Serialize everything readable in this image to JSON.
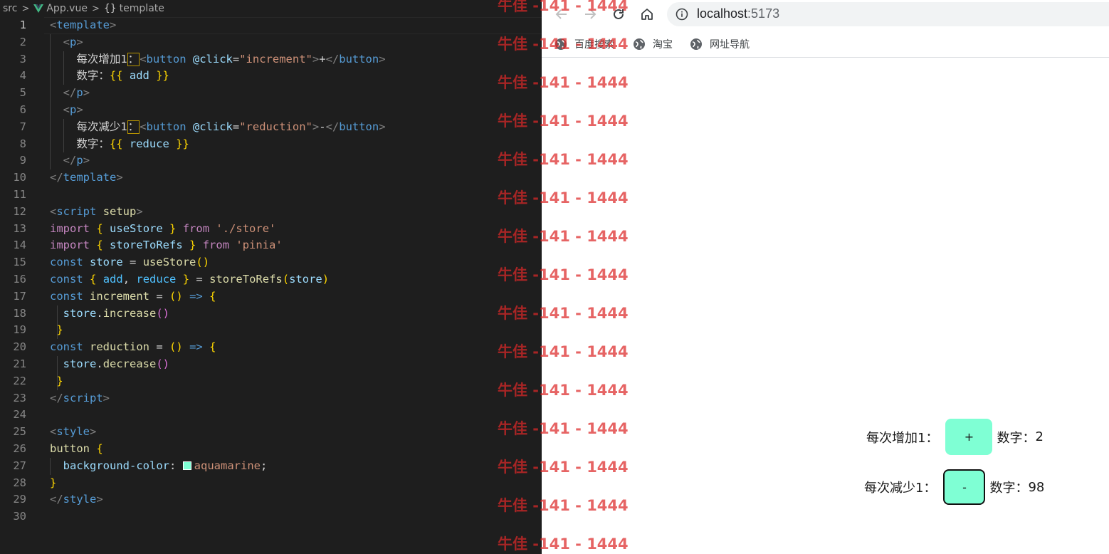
{
  "editor": {
    "breadcrumb": {
      "folder": "src",
      "file": "App.vue",
      "symbol": "template",
      "symbol_icon": "{}"
    },
    "active_line": 1,
    "line_numbers": [
      "1",
      "2",
      "3",
      "4",
      "5",
      "6",
      "7",
      "8",
      "9",
      "10",
      "11",
      "12",
      "13",
      "14",
      "15",
      "16",
      "17",
      "18",
      "19",
      "20",
      "21",
      "22",
      "23",
      "24",
      "25",
      "26",
      "27",
      "28",
      "29",
      "30"
    ],
    "code": {
      "l1": {
        "a": "<",
        "b": "template",
        "c": ">"
      },
      "l2": {
        "a": "<",
        "b": "p",
        "c": ">"
      },
      "l3": {
        "a": "每次增加1",
        "b": "：",
        "c": "<",
        "d": "button",
        "e": "@click",
        "f": "=",
        "g": "\"increment\"",
        "h": ">",
        "i": "+",
        "j": "</",
        "k": "button",
        "l": ">"
      },
      "l4": {
        "a": "数字：",
        "b": "{{",
        "c": "add",
        "d": "}}"
      },
      "l5": {
        "a": "</",
        "b": "p",
        "c": ">"
      },
      "l6": {
        "a": "<",
        "b": "p",
        "c": ">"
      },
      "l7": {
        "a": "每次减少1",
        "b": "：",
        "c": "<",
        "d": "button",
        "e": "@click",
        "f": "=",
        "g": "\"reduction\"",
        "h": ">",
        "i": "-",
        "j": "</",
        "k": "button",
        "l": ">"
      },
      "l8": {
        "a": "数字：",
        "b": "{{",
        "c": "reduce",
        "d": "}}"
      },
      "l9": {
        "a": "</",
        "b": "p",
        "c": ">"
      },
      "l10": {
        "a": "</",
        "b": "template",
        "c": ">"
      },
      "l12": {
        "a": "<",
        "b": "script",
        "c": "setup",
        "d": ">"
      },
      "l13": {
        "a": "import",
        "b": "{",
        "c": "useStore",
        "d": "}",
        "e": "from",
        "f": "'./store'"
      },
      "l14": {
        "a": "import",
        "b": "{",
        "c": "storeToRefs",
        "d": "}",
        "e": "from",
        "f": "'pinia'"
      },
      "l15": {
        "a": "const",
        "b": "store",
        "c": "=",
        "d": "useStore",
        "e": "()"
      },
      "l16": {
        "a": "const",
        "b": "{",
        "c": "add",
        "d": ",",
        "e": "reduce",
        "f": "}",
        "g": "=",
        "h": "storeToRefs",
        "i": "(",
        "j": "store",
        "k": ")"
      },
      "l17": {
        "a": "const",
        "b": "increment",
        "c": "=",
        "d": "()",
        "e": "=>",
        "f": "{"
      },
      "l18": {
        "a": "store",
        "b": ".",
        "c": "increase",
        "d": "()"
      },
      "l19": {
        "a": "}"
      },
      "l20": {
        "a": "const",
        "b": "reduction",
        "c": "=",
        "d": "()",
        "e": "=>",
        "f": "{"
      },
      "l21": {
        "a": "store",
        "b": ".",
        "c": "decrease",
        "d": "()"
      },
      "l22": {
        "a": "}"
      },
      "l23": {
        "a": "</",
        "b": "script",
        "c": ">"
      },
      "l25": {
        "a": "<",
        "b": "style",
        "c": ">"
      },
      "l26": {
        "a": "button",
        "b": "{"
      },
      "l27": {
        "a": "background-color",
        "b": ":",
        "c": "aquamarine",
        "d": ";"
      },
      "l28": {
        "a": "}"
      },
      "l29": {
        "a": "</",
        "b": "style",
        "c": ">"
      }
    },
    "swatch_color": "#7fffd4"
  },
  "watermark": {
    "text": "牛佳 -141 - 1444"
  },
  "browser": {
    "nav": {
      "back_icon": "arrow-left-icon",
      "forward_icon": "arrow-right-icon",
      "reload_icon": "reload-icon",
      "home_icon": "home-icon"
    },
    "address": {
      "host": "localhost",
      "port": ":5173"
    },
    "bookmarks": [
      {
        "label": "百度搜索"
      },
      {
        "label": "淘宝"
      },
      {
        "label": "网址导航"
      }
    ],
    "page": {
      "row1": {
        "label": "每次增加1：",
        "button": "+",
        "number_label": "数字：",
        "number": "2"
      },
      "row2": {
        "label": "每次减少1：",
        "button": "-",
        "number_label": "数字：",
        "number": "98"
      },
      "button_color": "#7fffd4"
    }
  }
}
